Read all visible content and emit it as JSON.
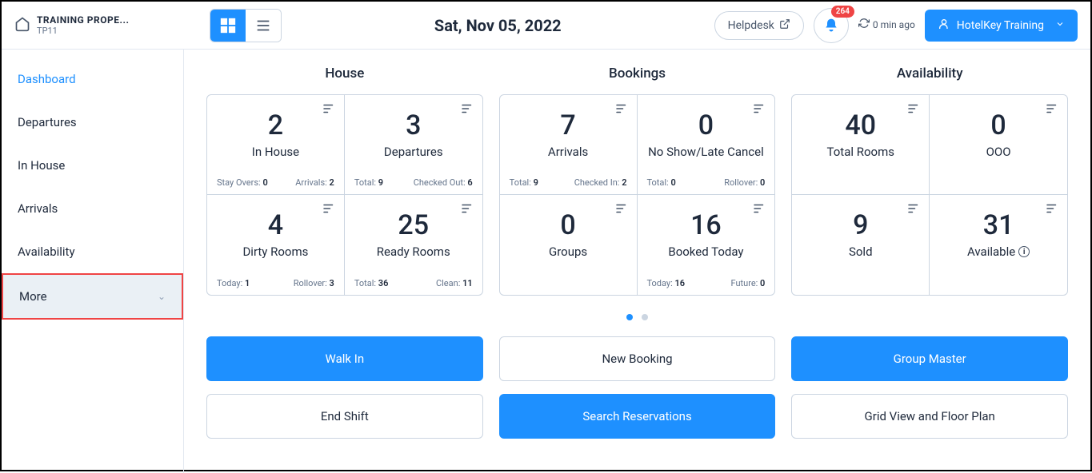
{
  "header": {
    "property_name": "TRAINING PROPE...",
    "property_code": "TP11",
    "date": "Sat, Nov 05, 2022",
    "helpdesk_label": "Helpdesk",
    "notif_count": "264",
    "sync_text": "0 min ago",
    "user_label": "HotelKey Training"
  },
  "sidebar": {
    "items": [
      "Dashboard",
      "Departures",
      "In House",
      "Arrivals",
      "Availability",
      "More"
    ]
  },
  "sections": {
    "house": "House",
    "bookings": "Bookings",
    "availability": "Availability"
  },
  "cards": {
    "house": [
      {
        "value": "2",
        "label": "In House",
        "stat1_label": "Stay Overs:",
        "stat1_value": "0",
        "stat2_label": "Arrivals:",
        "stat2_value": "2"
      },
      {
        "value": "3",
        "label": "Departures",
        "stat1_label": "Total:",
        "stat1_value": "9",
        "stat2_label": "Checked Out:",
        "stat2_value": "6"
      },
      {
        "value": "4",
        "label": "Dirty Rooms",
        "stat1_label": "Today:",
        "stat1_value": "1",
        "stat2_label": "Rollover:",
        "stat2_value": "3"
      },
      {
        "value": "25",
        "label": "Ready Rooms",
        "stat1_label": "Total:",
        "stat1_value": "36",
        "stat2_label": "Clean:",
        "stat2_value": "11"
      }
    ],
    "bookings": [
      {
        "value": "7",
        "label": "Arrivals",
        "stat1_label": "Total:",
        "stat1_value": "9",
        "stat2_label": "Checked In:",
        "stat2_value": "2"
      },
      {
        "value": "0",
        "label": "No Show/Late Cancel",
        "stat1_label": "Total:",
        "stat1_value": "0",
        "stat2_label": "Rollover:",
        "stat2_value": "0"
      },
      {
        "value": "0",
        "label": "Groups",
        "stat1_label": "",
        "stat1_value": "",
        "stat2_label": "",
        "stat2_value": ""
      },
      {
        "value": "16",
        "label": "Booked Today",
        "stat1_label": "Today:",
        "stat1_value": "16",
        "stat2_label": "Future:",
        "stat2_value": "0"
      }
    ],
    "availability": [
      {
        "value": "40",
        "label": "Total Rooms"
      },
      {
        "value": "0",
        "label": "OOO"
      },
      {
        "value": "9",
        "label": "Sold"
      },
      {
        "value": "31",
        "label": "Available",
        "info": true
      }
    ]
  },
  "buttons": {
    "walk_in": "Walk In",
    "new_booking": "New Booking",
    "group_master": "Group Master",
    "end_shift": "End Shift",
    "search_res": "Search Reservations",
    "grid_floor": "Grid View and Floor Plan"
  }
}
